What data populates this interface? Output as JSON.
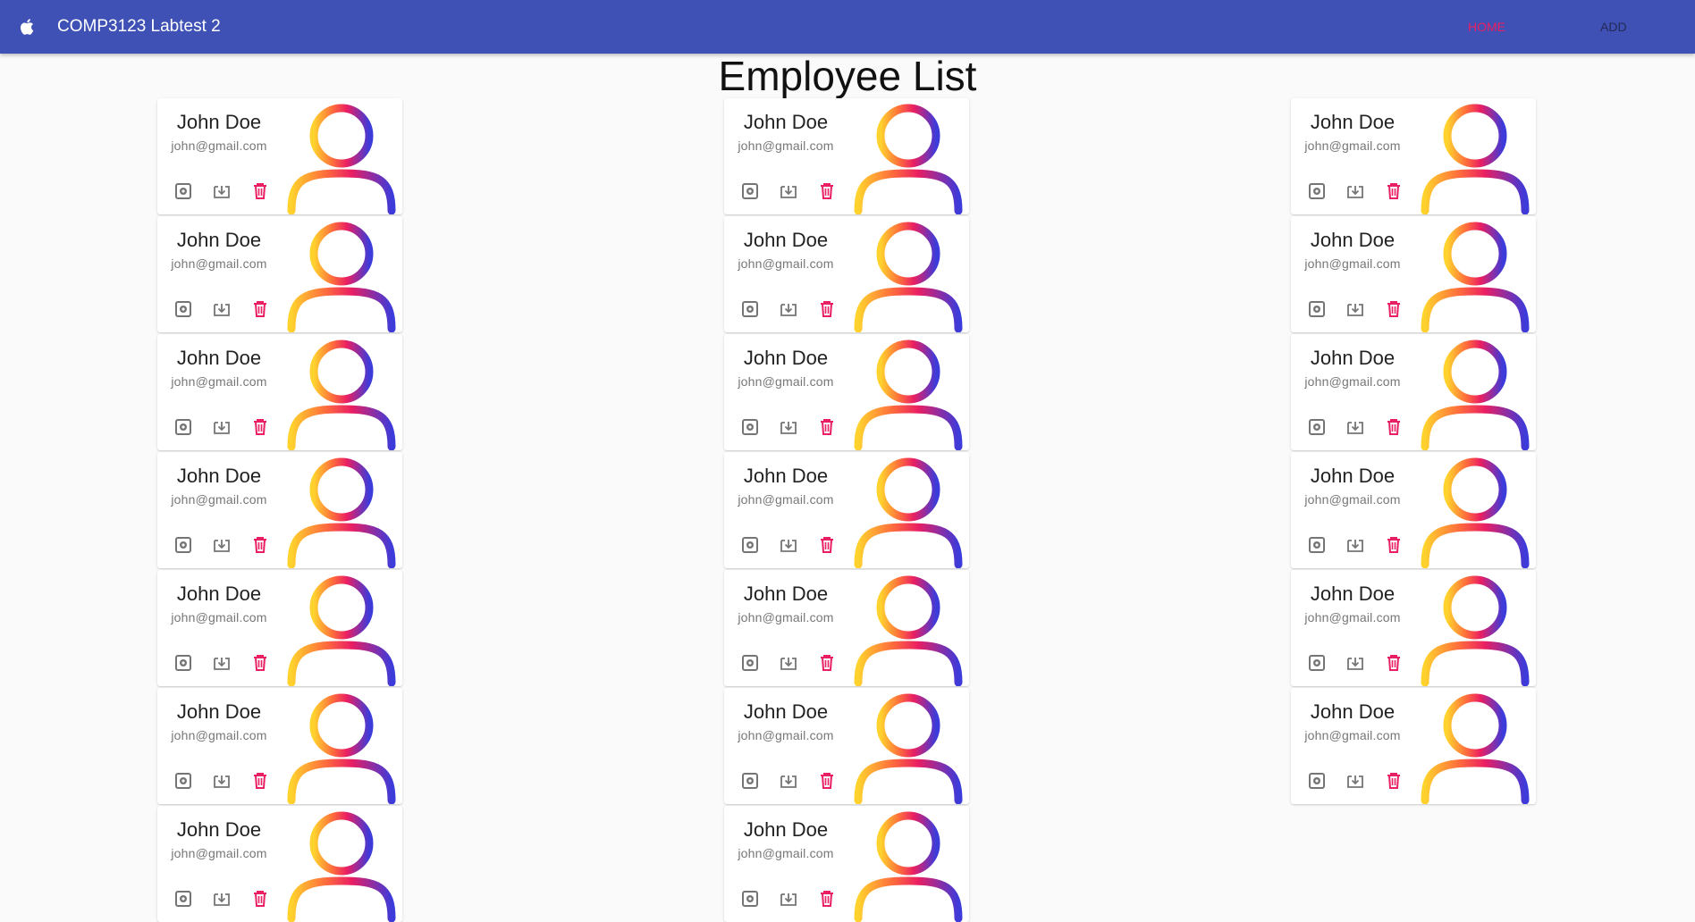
{
  "app": {
    "title": "COMP3123 Labtest 2",
    "nav": [
      {
        "label": "HOME",
        "active": true
      },
      {
        "label": "ADD",
        "active": false
      }
    ]
  },
  "page": {
    "title": "Employee List"
  },
  "colors": {
    "toolbar": "#3f51b5",
    "active_link": "#e91e63",
    "delete_icon": "#e91e63",
    "action_icon": "#757575"
  },
  "icons": {
    "logo": "apple-icon",
    "settings": "gear-icon",
    "download": "download-icon",
    "delete": "trash-icon",
    "avatar": "person-gradient-icon"
  },
  "columns": [
    {
      "employees": [
        {
          "name": "John Doe",
          "email": "john@gmail.com"
        },
        {
          "name": "John Doe",
          "email": "john@gmail.com"
        },
        {
          "name": "John Doe",
          "email": "john@gmail.com"
        },
        {
          "name": "John Doe",
          "email": "john@gmail.com"
        },
        {
          "name": "John Doe",
          "email": "john@gmail.com"
        },
        {
          "name": "John Doe",
          "email": "john@gmail.com"
        },
        {
          "name": "John Doe",
          "email": "john@gmail.com"
        }
      ]
    },
    {
      "employees": [
        {
          "name": "John Doe",
          "email": "john@gmail.com"
        },
        {
          "name": "John Doe",
          "email": "john@gmail.com"
        },
        {
          "name": "John Doe",
          "email": "john@gmail.com"
        },
        {
          "name": "John Doe",
          "email": "john@gmail.com"
        },
        {
          "name": "John Doe",
          "email": "john@gmail.com"
        },
        {
          "name": "John Doe",
          "email": "john@gmail.com"
        },
        {
          "name": "John Doe",
          "email": "john@gmail.com"
        }
      ]
    },
    {
      "employees": [
        {
          "name": "John Doe",
          "email": "john@gmail.com"
        },
        {
          "name": "John Doe",
          "email": "john@gmail.com"
        },
        {
          "name": "John Doe",
          "email": "john@gmail.com"
        },
        {
          "name": "John Doe",
          "email": "john@gmail.com"
        },
        {
          "name": "John Doe",
          "email": "john@gmail.com"
        },
        {
          "name": "John Doe",
          "email": "john@gmail.com"
        }
      ]
    }
  ]
}
